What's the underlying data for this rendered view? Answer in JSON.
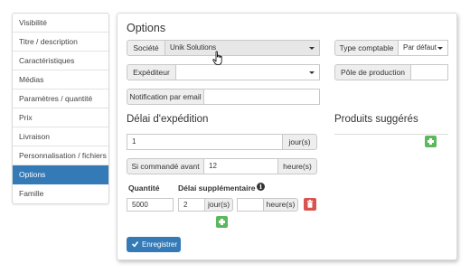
{
  "sidebar": {
    "items": [
      {
        "label": "Visibilité"
      },
      {
        "label": "Titre / description"
      },
      {
        "label": "Caractéristiques"
      },
      {
        "label": "Médias"
      },
      {
        "label": "Paramètres / quantité"
      },
      {
        "label": "Prix"
      },
      {
        "label": "Livraison"
      },
      {
        "label": "Personnalisation / fichiers"
      },
      {
        "label": "Options"
      },
      {
        "label": "Famille"
      }
    ],
    "active_index": 8
  },
  "main": {
    "title": "Options",
    "societe": {
      "label": "Société",
      "value": "Unik Solutions"
    },
    "expediteur": {
      "label": "Expéditeur",
      "value": ""
    },
    "notification": {
      "label": "Notification par email",
      "value": ""
    },
    "type_comptable": {
      "label": "Type comptable",
      "value": "Par défaut"
    },
    "pole_production": {
      "label": "Pôle de production",
      "value": ""
    },
    "delai": {
      "title": "Délai d'expédition",
      "days_value": "1",
      "days_unit": "jour(s)",
      "if_ordered_label": "Si commandé avant",
      "if_ordered_value": "12",
      "hours_unit": "heure(s)",
      "table": {
        "col_quantity": "Quantité",
        "col_extra_delay": "Délai supplémentaire",
        "rows": [
          {
            "quantity": "5000",
            "days": "2",
            "days_unit": "jour(s)",
            "hours": "",
            "hours_unit": "heure(s)"
          }
        ]
      }
    },
    "suggested": {
      "title": "Produits suggérés"
    },
    "save_button": "Enregistrer"
  },
  "colors": {
    "primary": "#337ab7",
    "success": "#5cb85c",
    "danger": "#d9534f"
  },
  "icons": [
    "info-icon",
    "trash-icon",
    "plus-icon",
    "check-icon",
    "hand-cursor-icon"
  ]
}
